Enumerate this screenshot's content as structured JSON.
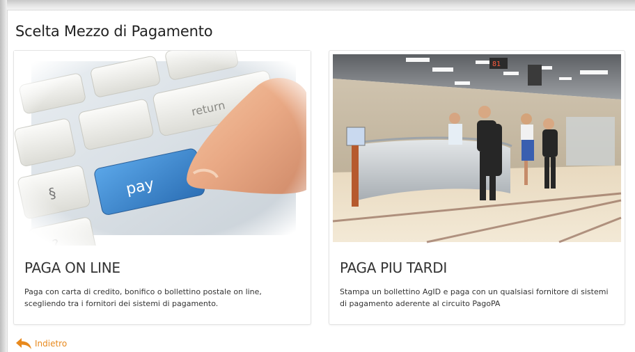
{
  "page": {
    "title": "Scelta Mezzo di Pagamento"
  },
  "options": [
    {
      "title": "PAGA ON LINE",
      "description": "Paga con carta di credito, bonifico o bollettino postale on line, scegliendo tra i fornitori dei sistemi di pagamento.",
      "image_keys": {
        "pay": "pay",
        "return": "return",
        "section": "§",
        "question": "?"
      }
    },
    {
      "title": "PAGA PIU TARDI",
      "description": "Stampa un bollettino AgID e paga con un qualsiasi fornitore di sistemi di pagamento aderente al circuito PagoPA",
      "display_number": "81"
    }
  ],
  "back": {
    "label": "Indietro",
    "icon": "back-arrow-icon"
  },
  "colors": {
    "accent": "#e8891d",
    "pay_key": "#3d86cf"
  }
}
